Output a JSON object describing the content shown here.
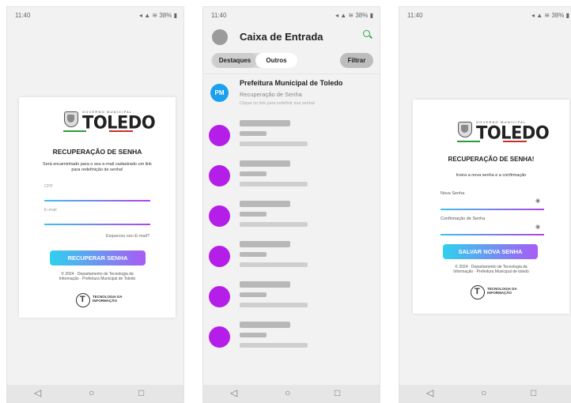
{
  "status_bar": {
    "time": "11:40",
    "indicators": "38%"
  },
  "nav_bar": {
    "back": "◁",
    "home": "○",
    "recent": "□"
  },
  "logo": {
    "gov": "GOVERNO MUNICIPAL",
    "city": "TOLEDO"
  },
  "screen1": {
    "heading": "RECUPERAÇÃO DE SENHA",
    "instructions": "Será encaminhado para o seu e-mail cadastrado um link para redefinição de senha!",
    "field1_label": "CPF",
    "field2_label": "E-mail",
    "forgot_link": "Esqueceu seu E-mail?",
    "button": "RECUPERAR SENHA",
    "footer": "© 2024 · Departamento de Tecnologia da Informação · Prefeitura Municipal de Toledo",
    "ti_logo": "TECNOLOGIA DA INFORMAÇÃO"
  },
  "screen2": {
    "title": "Caixa de Entrada",
    "tab_highlights": "Destaques",
    "tab_others": "Outros",
    "filter": "Filtrar",
    "email": {
      "avatar": "PM",
      "sender": "Prefeitura Municipal de Toledo",
      "subject": "Recuperação de Senha",
      "preview": "Clique no link para redefinir sua senha!"
    },
    "placeholder_count": 6
  },
  "screen3": {
    "heading": "RECUPERAÇÃO DE SENHA!",
    "instructions": "Insira a nova senha e a confirmação",
    "field1_label": "Nova Senha",
    "field2_label": "Confirmação de Senha",
    "button": "SALVAR NOVA SENHA",
    "footer": "© 2024 · Departamento de Tecnologia da Informação · Prefeitura Municipal de toledo",
    "ti_logo": "TECNOLOGIA DA INFORMAÇÃO"
  },
  "colors": {
    "gradient_start": "#2fd0ee",
    "gradient_end": "#a85cf3",
    "placeholder_avatar": "#b41ee8",
    "pm_avatar": "#1aa0ee",
    "search_icon": "#2aa84a"
  }
}
